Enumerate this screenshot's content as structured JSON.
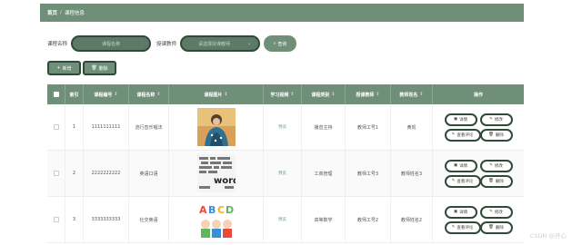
{
  "breadcrumb": {
    "home": "首页",
    "sep": "/",
    "current": "课程信息"
  },
  "search": {
    "name_label": "课程名称",
    "name_placeholder": "课程名称",
    "teacher_label": "授课教师",
    "teacher_placeholder": "请选择授课教师",
    "search_button": "查询"
  },
  "toolbar": {
    "add_label": "新增",
    "delete_label": "删除"
  },
  "table": {
    "headers": {
      "index": "索引",
      "code": "课程编号",
      "name": "课程名称",
      "image": "课程图片",
      "video": "学习视频",
      "type": "课程类别",
      "teacher": "授课教师",
      "teacher_name": "教师姓名",
      "ops": "操作"
    },
    "rows": [
      {
        "index": "1",
        "code": "1111111111",
        "name": "流行音乐唱法",
        "video": "预览",
        "type": "播音主持",
        "teacher": "教师工号1",
        "teacher_name": "黄凯"
      },
      {
        "index": "2",
        "code": "2222222222",
        "name": "英语口语",
        "video": "预览",
        "type": "工商管理",
        "teacher": "教师工号3",
        "teacher_name": "教师姓名3"
      },
      {
        "index": "3",
        "code": "3333333333",
        "name": "社交英语",
        "video": "预览",
        "type": "高等数学",
        "teacher": "教师工号2",
        "teacher_name": "教师姓名2"
      }
    ],
    "ops": {
      "detail": "详情",
      "edit": "修改",
      "review": "查看评论",
      "delete": "删除"
    },
    "thumb_words": "words",
    "thumb_abcd": [
      "A",
      "B",
      "C",
      "D"
    ]
  },
  "watermark": "CSDN @开心",
  "colors": {
    "primary": "#6f8f79",
    "dark_border": "#2f4a38"
  }
}
